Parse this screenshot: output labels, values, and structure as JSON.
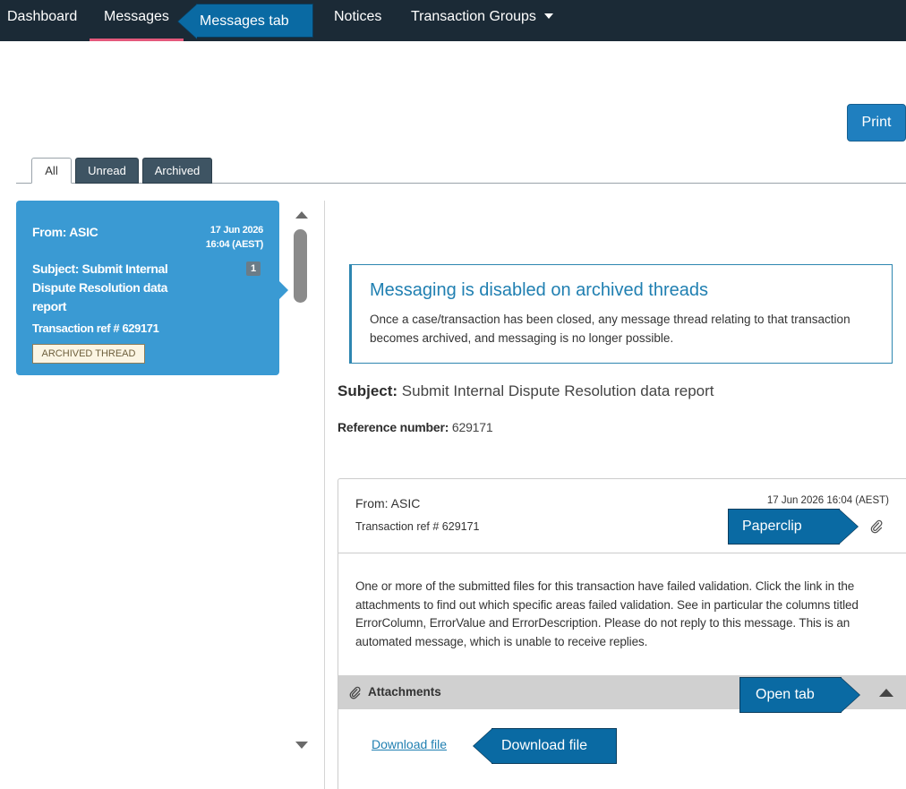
{
  "nav": {
    "items": [
      {
        "label": "Dashboard"
      },
      {
        "label": "Messages"
      },
      {
        "label": "Notices"
      },
      {
        "label": "Transaction Groups"
      }
    ]
  },
  "annotations": {
    "messages_tab": "Messages tab",
    "paperclip": "Paperclip",
    "open_tab": "Open tab",
    "download_file": "Download file"
  },
  "toolbar": {
    "print_label": "Print"
  },
  "tabs": [
    {
      "label": "All",
      "active": true
    },
    {
      "label": "Unread",
      "active": false
    },
    {
      "label": "Archived",
      "active": false
    }
  ],
  "thread": {
    "from": "From: ASIC",
    "date_line1": "17 Jun 2026",
    "date_line2": "16:04 (AEST)",
    "subject": "Subject: Submit Internal Dispute Resolution data report",
    "count": "1",
    "ref": "Transaction ref # 629171",
    "badge": "ARCHIVED THREAD"
  },
  "notice": {
    "title": "Messaging is disabled on archived threads",
    "body": "Once a case/transaction has been closed, any message thread relating to that transaction becomes archived, and messaging is no longer possible."
  },
  "detail": {
    "subject_label": "Subject:",
    "subject_value": "Submit Internal Dispute Resolution data report",
    "ref_label": "Reference number:",
    "ref_value": "629171"
  },
  "message": {
    "from": "From: ASIC",
    "ref": "Transaction ref # 629171",
    "date": "17 Jun 2026 16:04 (AEST)",
    "body": "One or more of the submitted files for this transaction have failed validation. Click the link in the attachments to find out which specific areas failed validation. See in particular the columns titled ErrorColumn, ErrorValue and ErrorDescription. Please do not reply to this message. This is an automated message, which is unable to receive replies.",
    "attachments_label": "Attachments",
    "download_label": "Download file"
  },
  "colors": {
    "nav_bg": "#1b2a36",
    "accent": "#1f7fbf",
    "card_bg": "#3a9ad3",
    "callout_bg": "#0a6aa3",
    "active_tab_underline": "#e4597c"
  },
  "icons": [
    "caret-down-icon",
    "scroll-up-icon",
    "scroll-down-icon",
    "paperclip-icon",
    "chevron-up-icon"
  ]
}
